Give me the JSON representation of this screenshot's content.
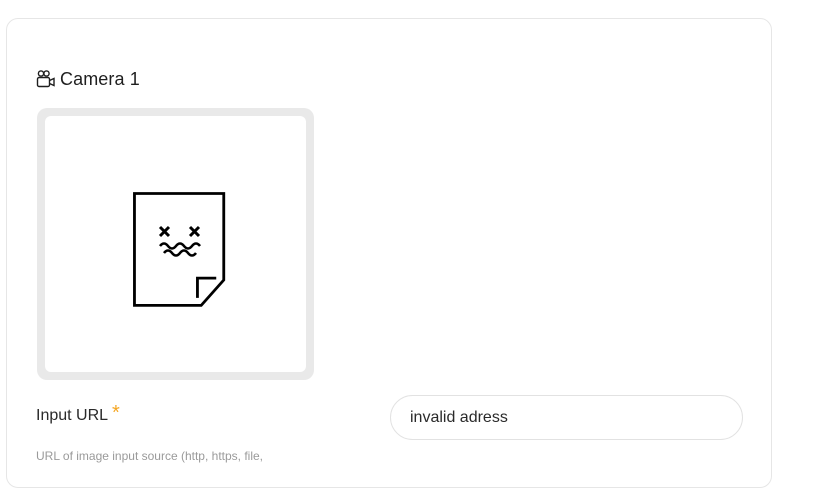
{
  "camera": {
    "title": "Camera 1",
    "icon": "video-camera-icon"
  },
  "preview": {
    "icon": "broken-file-icon"
  },
  "input_url": {
    "label": "Input URL",
    "required_mark": "*",
    "value": "invalid adress",
    "help_text": "URL of image input source (http, https, file,"
  },
  "colors": {
    "required_star": "#f5a623",
    "frame_bg": "#e9e9e9",
    "border": "#e6e6e6",
    "help_text": "#9a9a9a"
  }
}
